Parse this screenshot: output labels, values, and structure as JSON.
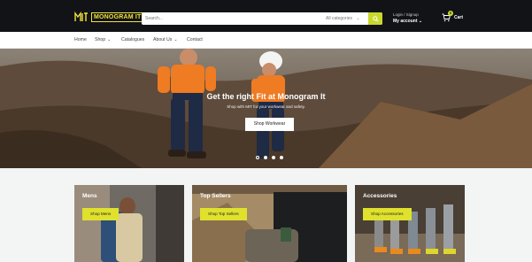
{
  "header": {
    "logo_text": "MONOGRAM IT",
    "search": {
      "placeholder": "Search...",
      "category": "All categories"
    },
    "account": {
      "line1": "Login / Signup",
      "line2": "My account"
    },
    "cart": {
      "label": "Cart",
      "count": "0"
    }
  },
  "nav": {
    "items": [
      {
        "label": "Home"
      },
      {
        "label": "Shop"
      },
      {
        "label": "Catalogues"
      },
      {
        "label": "About Us"
      },
      {
        "label": "Contact"
      }
    ]
  },
  "hero": {
    "title": "Get the right Fit at Monogram It",
    "subtitle": "Shop with MIT for your workwear and safety.",
    "button": "Shop Workwear",
    "slides": 4,
    "active_slide": 3
  },
  "categories": [
    {
      "title": "Mens",
      "button": "Shop Mens"
    },
    {
      "title": "Top Sellers",
      "button": "Shop Top Sellers"
    },
    {
      "title": "Accessories",
      "button": "Shop Accessories"
    }
  ],
  "colors": {
    "accent": "#dfe12d",
    "topbar": "#111316"
  }
}
